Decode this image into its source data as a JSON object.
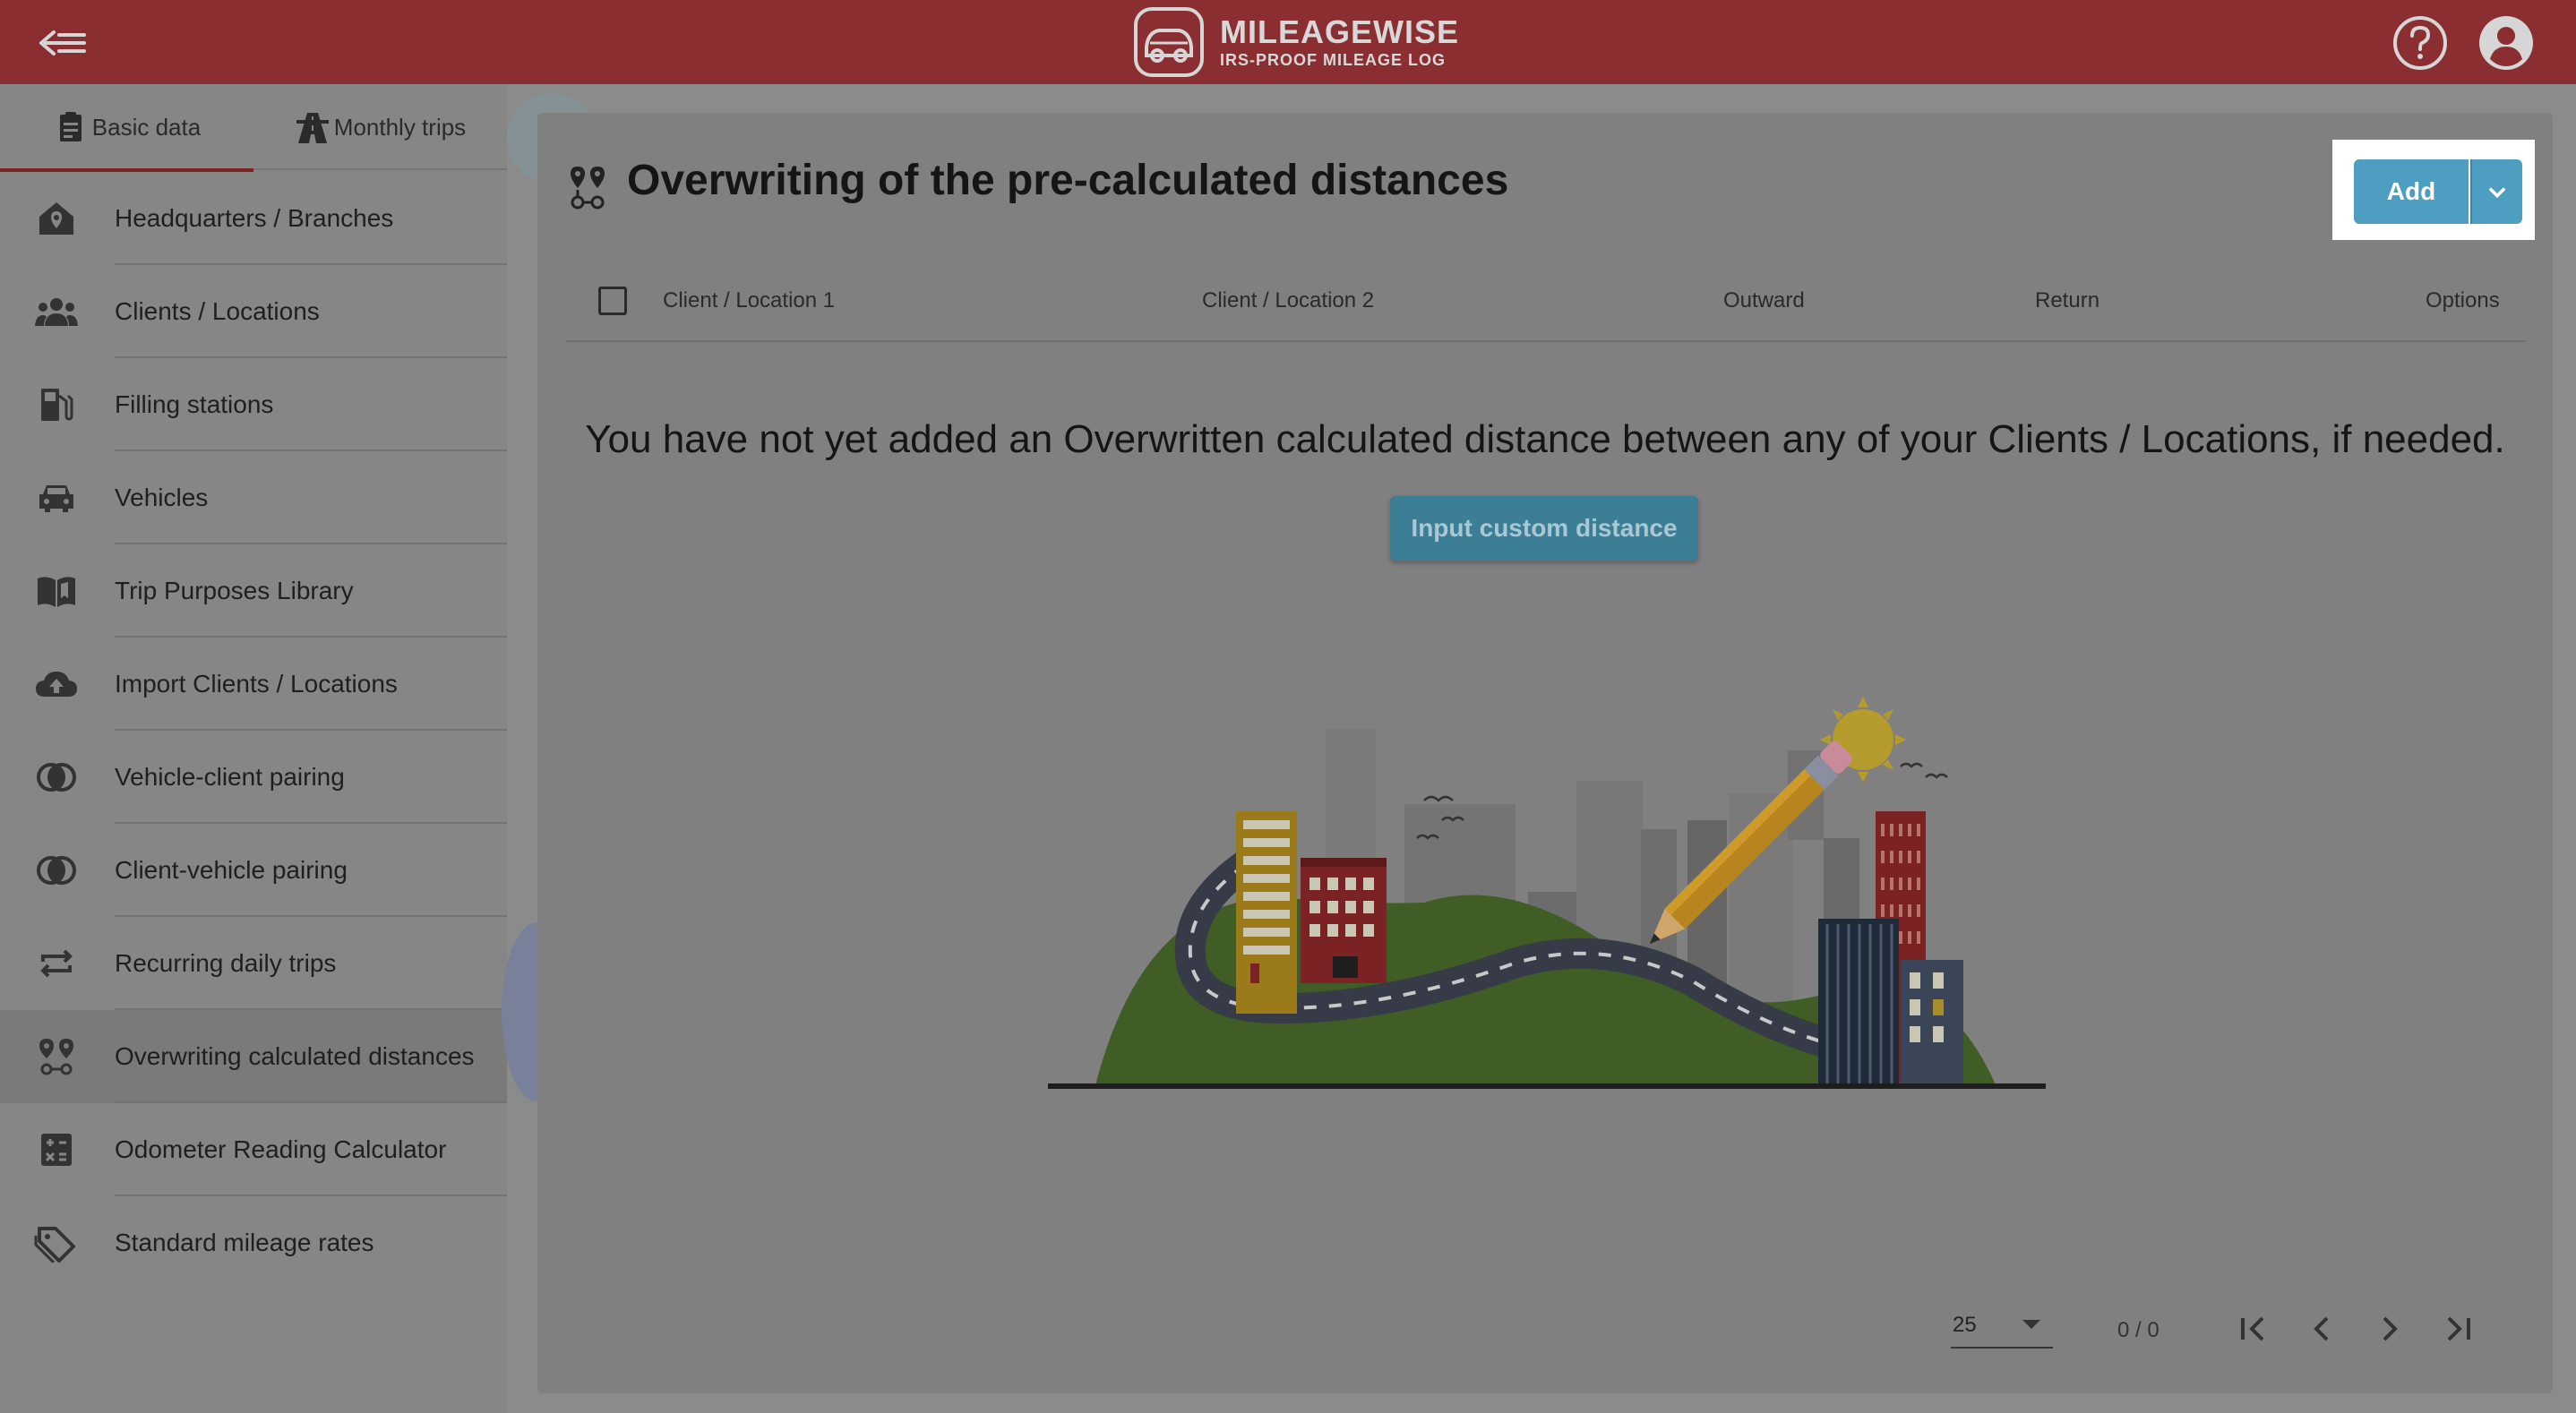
{
  "header": {
    "brand_name": "MILEAGEWISE",
    "brand_tagline": "IRS-PROOF MILEAGE LOG"
  },
  "sidebar": {
    "tabs": [
      {
        "label": "Basic data",
        "icon": "clipboard-icon",
        "active": true
      },
      {
        "label": "Monthly trips",
        "icon": "road-icon",
        "active": false
      }
    ],
    "items": [
      {
        "label": "Headquarters / Branches",
        "icon": "home-pin-icon"
      },
      {
        "label": "Clients / Locations",
        "icon": "people-icon"
      },
      {
        "label": "Filling stations",
        "icon": "gas-station-icon"
      },
      {
        "label": "Vehicles",
        "icon": "car-icon"
      },
      {
        "label": "Trip Purposes Library",
        "icon": "book-icon"
      },
      {
        "label": "Import Clients / Locations",
        "icon": "cloud-upload-icon"
      },
      {
        "label": "Vehicle-client pairing",
        "icon": "pairing-icon"
      },
      {
        "label": "Client-vehicle pairing",
        "icon": "pairing-icon"
      },
      {
        "label": "Recurring daily trips",
        "icon": "repeat-icon"
      },
      {
        "label": "Overwriting calculated distances",
        "icon": "route-pins-icon",
        "selected": true
      },
      {
        "label": "Odometer Reading Calculator",
        "icon": "calculator-icon"
      },
      {
        "label": "Standard mileage rates",
        "icon": "tag-icon"
      }
    ]
  },
  "main": {
    "title": "Overwriting of the pre-calculated distances",
    "add_label": "Add",
    "columns": {
      "client1": "Client / Location 1",
      "client2": "Client / Location 2",
      "outward": "Outward",
      "return": "Return",
      "options": "Options"
    },
    "empty_message": "You have not yet added an Overwritten calculated distance between any of your Clients / Locations, if needed.",
    "custom_distance_label": "Input custom distance",
    "pagination": {
      "page_size": "25",
      "range": "0 / 0"
    }
  },
  "colors": {
    "header": "#8a2e31",
    "accent_button": "#4e9ec2",
    "overlay_background": "#808080"
  }
}
